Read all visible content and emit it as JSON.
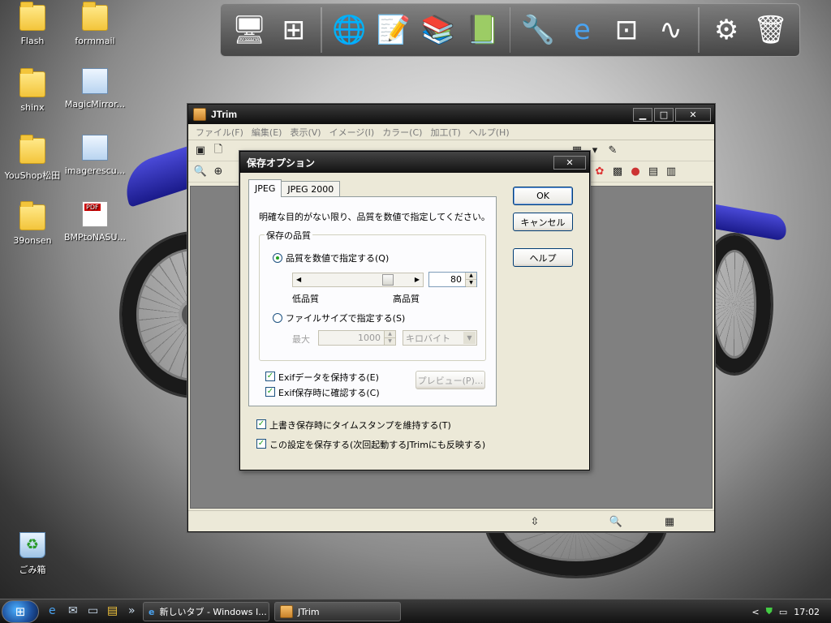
{
  "desktop": {
    "icons": [
      {
        "label": "Flash",
        "type": "folder"
      },
      {
        "label": "formmail",
        "type": "folder"
      },
      {
        "label": "shinx",
        "type": "folder"
      },
      {
        "label": "MagicMirror...",
        "type": "file"
      },
      {
        "label": "YouShop松田",
        "type": "folder"
      },
      {
        "label": "imagerescu...",
        "type": "file"
      },
      {
        "label": "39onsen",
        "type": "folder"
      },
      {
        "label": "BMPtoNASU...",
        "type": "pdf"
      },
      {
        "label": "ごみ箱",
        "type": "recycle"
      }
    ]
  },
  "dock": {
    "items": [
      "monitor-icon",
      "network-icon",
      "globe-icon",
      "notes-icon",
      "library-icon",
      "books-icon",
      "wrench-icon",
      "ie-icon",
      "windows-icon",
      "wave-icon",
      "gear-icon",
      "trash-icon"
    ]
  },
  "jtrim": {
    "title": "JTrim",
    "menu": [
      "ファイル(F)",
      "編集(E)",
      "表示(V)",
      "イメージ(I)",
      "カラー(C)",
      "加工(T)",
      "ヘルプ(H)"
    ]
  },
  "dialog": {
    "title": "保存オプション",
    "tabs": [
      "JPEG",
      "JPEG 2000"
    ],
    "instruction": "明確な目的がない限り、品質を数値で指定してください。",
    "group_label": "保存の品質",
    "radio_quality": "品質を数値で指定する(Q)",
    "low_label": "低品質",
    "high_label": "高品質",
    "quality_value": "80",
    "quality_level": 80,
    "radio_filesize": "ファイルサイズで指定する(S)",
    "max_label": "最大",
    "max_value": "1000",
    "unit_select": "キロバイト",
    "exif_keep": "Exifデータを保持する(E)",
    "exif_confirm": "Exif保存時に確認する(C)",
    "preview_button": "プレビュー(P)...",
    "timestamp_keep": "上書き保存時にタイムスタンプを維持する(T)",
    "save_settings": "この設定を保存する(次回起動するJTrimにも反映する)",
    "ok_button": "OK",
    "cancel_button": "キャンセル",
    "help_button": "ヘルプ"
  },
  "taskbar": {
    "chevron": "»",
    "tasks": [
      {
        "label": "新しいタブ - Windows I..."
      },
      {
        "label": "JTrim"
      }
    ],
    "tray_chevron": "<",
    "clock": "17:02"
  }
}
